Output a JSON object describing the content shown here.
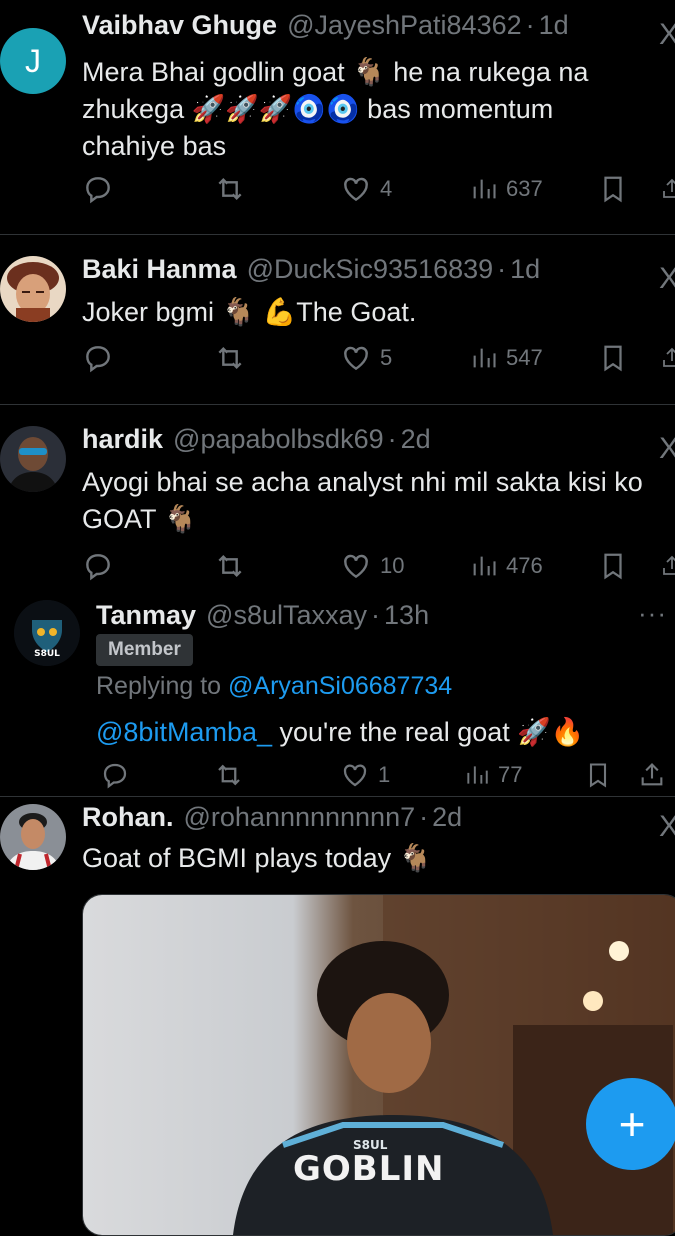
{
  "tweets": [
    {
      "name": "Vaibhav Ghuge",
      "handle": "@JayeshPati84362",
      "time": "1d",
      "avatar_letter": "J",
      "text": "Mera Bhai godlin goat 🐐 he na rukega na zhukega 🚀🚀🚀🧿🧿 bas momentum chahiye bas",
      "replies": "",
      "reposts": "",
      "likes": "4",
      "views": "637"
    },
    {
      "name": "Baki Hanma",
      "handle": "@DuckSic93516839",
      "time": "1d",
      "text": "Joker bgmi 🐐 💪The Goat.",
      "replies": "",
      "reposts": "",
      "likes": "5",
      "views": "547"
    },
    {
      "name": "hardik",
      "handle": "@papabolbsdk69",
      "time": "2d",
      "text": "Ayogi bhai se acha analyst nhi mil sakta kisi ko GOAT 🐐",
      "replies": "",
      "reposts": "",
      "likes": "10",
      "views": "476"
    },
    {
      "name": "Tanmay",
      "handle": "@s8ulTaxxay",
      "time": "13h",
      "badge": "Member",
      "replying_prefix": "Replying to ",
      "replying_to": "@AryanSi06687734",
      "mention": "@8bitMamba_",
      "text": " you're the real goat 🚀🔥",
      "replies": "",
      "reposts": "",
      "likes": "1",
      "views": "77"
    },
    {
      "name": "Rohan.",
      "handle": "@rohannnnnnnnn7",
      "time": "2d",
      "text": "Goat of BGMI plays today 🐐",
      "media_jersey_text": "GOBLIN"
    }
  ],
  "colors": {
    "background": "#000000",
    "accent": "#1d9bf0",
    "muted": "#71767b",
    "divider": "#2f3336",
    "avatar_teal": "#1aa1b4"
  },
  "icons": [
    "reply-icon",
    "repost-icon",
    "like-icon",
    "views-icon",
    "bookmark-icon",
    "share-icon",
    "more-icon",
    "x-logo-icon",
    "compose-icon"
  ]
}
